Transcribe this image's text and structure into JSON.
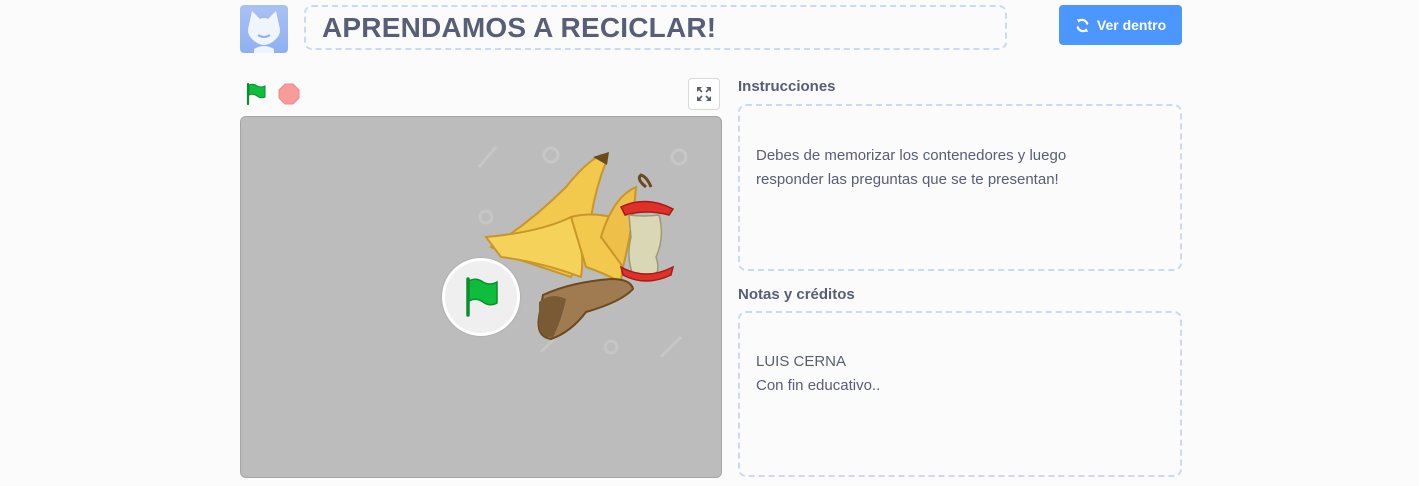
{
  "header": {
    "title": "APRENDAMOS A RECICLAR!",
    "remix_label": "Ver dentro"
  },
  "icons": {
    "avatar": "scratch-cat-avatar",
    "remix": "remix-arrows-icon",
    "green_flag": "green-flag-icon",
    "stop": "stop-sign-icon",
    "fullscreen": "fullscreen-icon"
  },
  "sections": {
    "instructions_label": "Instrucciones",
    "instructions_text": "Debes de memorizar los contenedores y luego\nresponder las preguntas que se te presentan!",
    "credits_label": "Notas y créditos",
    "credits_text": "LUIS CERNA\nCon fin educativo.."
  },
  "colors": {
    "accent": "#4c97ff",
    "text": "#575e75",
    "flag_green": "#0fbd3c",
    "stop_red": "#f79b9b",
    "stage_bg": "#bcbcbc",
    "dashed_border": "#c9d9f7"
  }
}
